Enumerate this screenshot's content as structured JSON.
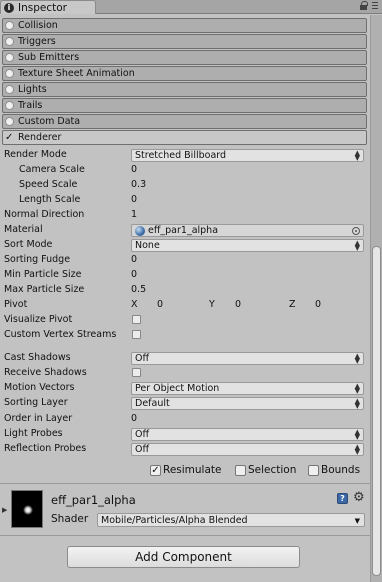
{
  "tab": {
    "title": "Inspector"
  },
  "modules": [
    {
      "label": "Collision",
      "enabled": false
    },
    {
      "label": "Triggers",
      "enabled": false
    },
    {
      "label": "Sub Emitters",
      "enabled": false
    },
    {
      "label": "Texture Sheet Animation",
      "enabled": false
    },
    {
      "label": "Lights",
      "enabled": false
    },
    {
      "label": "Trails",
      "enabled": false
    },
    {
      "label": "Custom Data",
      "enabled": false
    },
    {
      "label": "Renderer",
      "enabled": true
    }
  ],
  "renderer": {
    "render_mode": {
      "label": "Render Mode",
      "value": "Stretched Billboard"
    },
    "camera_scale": {
      "label": "Camera Scale",
      "value": "0"
    },
    "speed_scale": {
      "label": "Speed Scale",
      "value": "0.3"
    },
    "length_scale": {
      "label": "Length Scale",
      "value": "0"
    },
    "normal_direction": {
      "label": "Normal Direction",
      "value": "1"
    },
    "material": {
      "label": "Material",
      "value": "eff_par1_alpha"
    },
    "sort_mode": {
      "label": "Sort Mode",
      "value": "None"
    },
    "sorting_fudge": {
      "label": "Sorting Fudge",
      "value": "0"
    },
    "min_particle_size": {
      "label": "Min Particle Size",
      "value": "0"
    },
    "max_particle_size": {
      "label": "Max Particle Size",
      "value": "0.5"
    },
    "pivot": {
      "label": "Pivot",
      "x_label": "X",
      "x": "0",
      "y_label": "Y",
      "y": "0",
      "z_label": "Z",
      "z": "0"
    },
    "visualize_pivot": {
      "label": "Visualize Pivot",
      "checked": false
    },
    "custom_vertex_streams": {
      "label": "Custom Vertex Streams",
      "checked": false
    },
    "cast_shadows": {
      "label": "Cast Shadows",
      "value": "Off"
    },
    "receive_shadows": {
      "label": "Receive Shadows",
      "checked": false
    },
    "motion_vectors": {
      "label": "Motion Vectors",
      "value": "Per Object Motion"
    },
    "sorting_layer": {
      "label": "Sorting Layer",
      "value": "Default"
    },
    "order_in_layer": {
      "label": "Order in Layer",
      "value": "0"
    },
    "light_probes": {
      "label": "Light Probes",
      "value": "Off"
    },
    "reflection_probes": {
      "label": "Reflection Probes",
      "value": "Off"
    }
  },
  "bottom_toggles": {
    "resimulate": {
      "label": "Resimulate",
      "checked": true
    },
    "selection": {
      "label": "Selection",
      "checked": false
    },
    "bounds": {
      "label": "Bounds",
      "checked": false
    }
  },
  "material_section": {
    "name": "eff_par1_alpha",
    "shader_label": "Shader",
    "shader_value": "Mobile/Particles/Alpha Blended"
  },
  "add_component": {
    "label": "Add Component"
  },
  "icons": {
    "tab": "info-icon",
    "lock": "lock-icon",
    "menu": "menu-icon",
    "help": "help-icon",
    "settings": "gear-icon"
  },
  "colors": {
    "background": "#c2c2c2",
    "header": "#aeaeae",
    "help_icon": "#3c68a8"
  }
}
